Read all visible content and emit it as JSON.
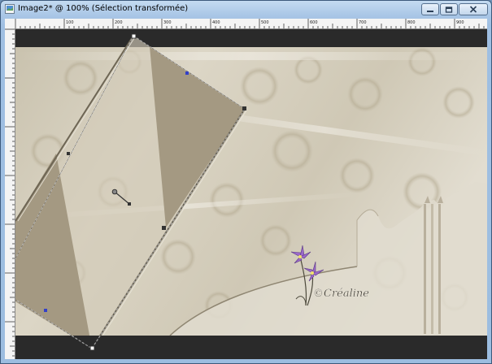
{
  "window": {
    "title": "Image2* @ 100% (Sélection transformée)",
    "icons": {
      "app": "image-document-icon",
      "minimize": "minimize-icon",
      "maximize": "maximize-icon",
      "close": "close-icon"
    }
  },
  "ruler": {
    "top_labels": [
      "100",
      "200",
      "300",
      "400",
      "500",
      "600",
      "700",
      "800",
      "900"
    ]
  },
  "artwork": {
    "signature_text": "©Créaline",
    "colors": {
      "canvas_background": "#2a2a2a",
      "paper": "#d7d1c0",
      "paper_shadow": "#bdb49f",
      "triangle_fill": "#a49982",
      "flower": "#9b69c9",
      "handle": "#3340c8"
    },
    "flower_icon": "purple-flower-icon"
  }
}
